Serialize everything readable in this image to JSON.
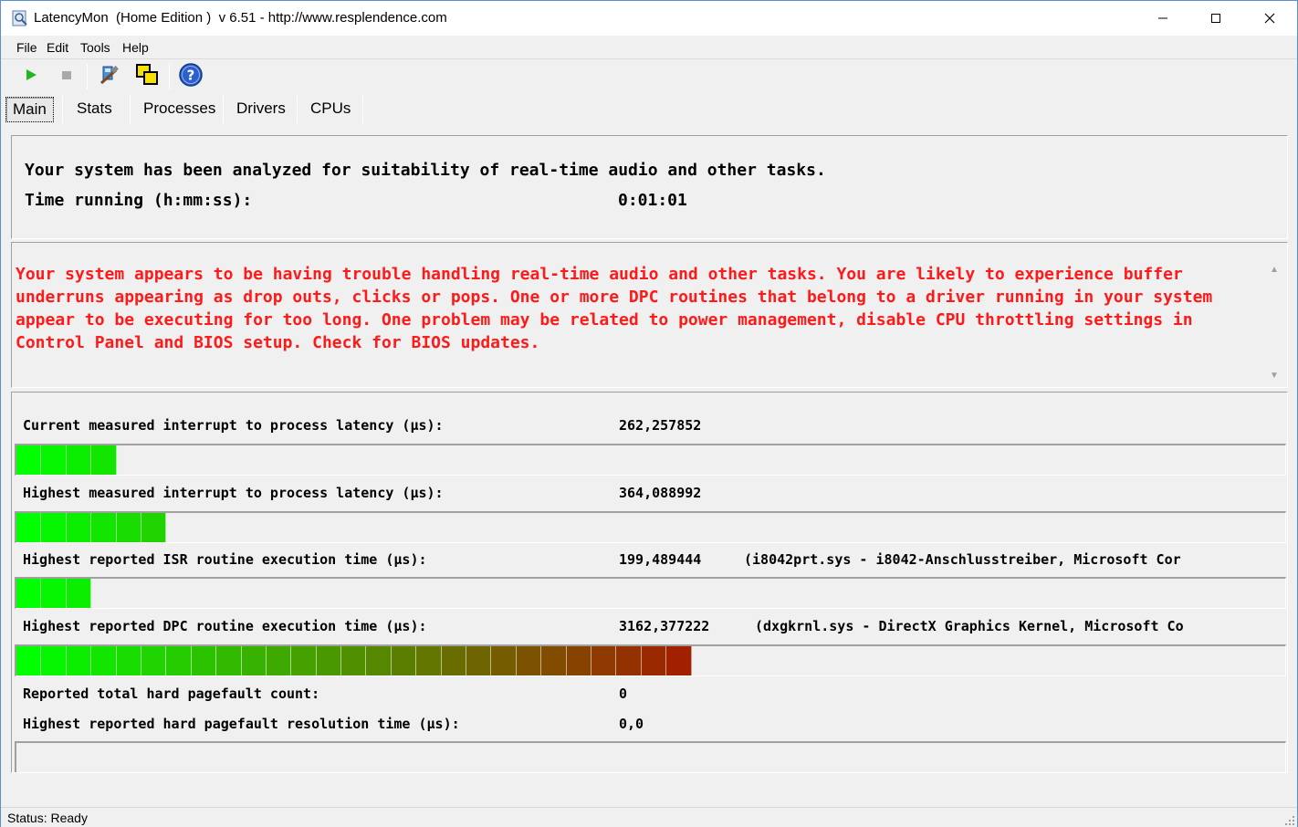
{
  "window": {
    "title": "LatencyMon  (Home Edition )  v 6.51 - http://www.resplendence.com",
    "minimize_glyph": "—",
    "maximize_glyph": "☐",
    "close_glyph": "✕"
  },
  "menu": {
    "file": "File",
    "edit": "Edit",
    "tools": "Tools",
    "help": "Help"
  },
  "toolbar": {
    "icons": [
      "play-icon",
      "stop-icon",
      "tools-icon",
      "windows-icon",
      "help-icon"
    ]
  },
  "tabs": {
    "main": "Main",
    "stats": "Stats",
    "processes": "Processes",
    "drivers": "Drivers",
    "cpus": "CPUs",
    "active": "Main"
  },
  "summary": {
    "line1": "Your system has been analyzed for suitability of real-time audio and other tasks.",
    "line2": "Time running (h:mm:ss):",
    "time_running": "0:01:01"
  },
  "warning": {
    "text": "Your system appears to be having trouble handling real-time audio and other tasks. You are likely to experience buffer underruns appearing as drop outs, clicks or pops. One or more DPC routines that belong to a driver running in your system appear to be executing for too long. One problem may be related to power management, disable CPU throttling settings in Control Panel and BIOS setup. Check for BIOS updates.",
    "color": "#ff1a1a"
  },
  "measures": [
    {
      "label": "Current measured interrupt to process latency (µs):",
      "value": "262,257852",
      "extra": "",
      "segments": 4
    },
    {
      "label": "Highest measured interrupt to process latency (µs):",
      "value": "364,088992",
      "extra": "",
      "segments": 6
    },
    {
      "label": "Highest reported ISR routine execution time (µs):",
      "value": "199,489444",
      "extra": "(i8042prt.sys - i8042-Anschlusstreiber, Microsoft Cor",
      "segments": 3
    },
    {
      "label": "Highest reported DPC routine execution time (µs):",
      "value": "3162,377222",
      "extra": "(dxgkrnl.sys - DirectX Graphics Kernel, Microsoft Co",
      "segments": 27
    },
    {
      "label": "Reported total hard pagefault count:",
      "value": "0",
      "extra": ""
    },
    {
      "label": "Highest reported hard pagefault resolution time (µs):",
      "value": "0,0",
      "extra": "",
      "segments": 0
    }
  ],
  "status": {
    "text": "Status: Ready"
  },
  "colors": {
    "bar_start": "#00ff00",
    "bar_end": "#a02000",
    "window_border": "#5a8fd0"
  }
}
